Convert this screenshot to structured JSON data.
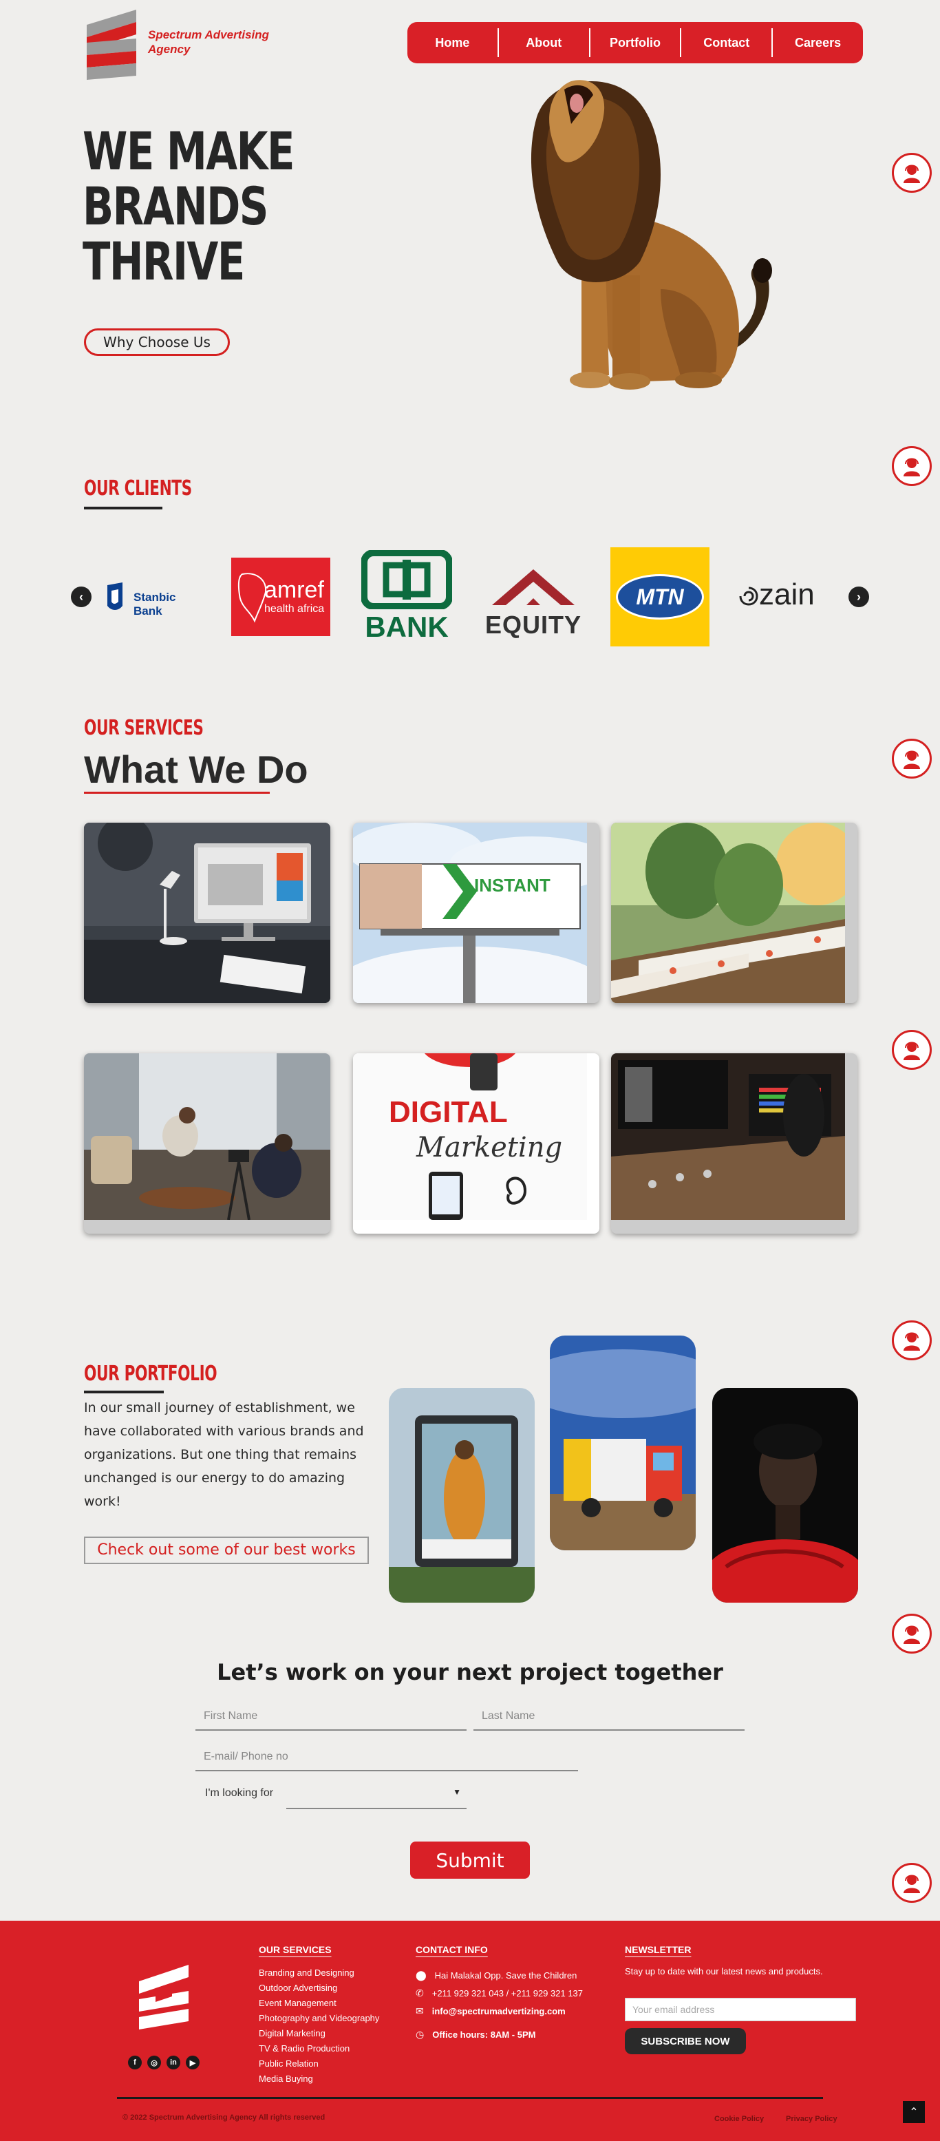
{
  "brand": {
    "name_line1": "Spectrum Advertising",
    "name_line2": "Agency"
  },
  "nav": {
    "items": [
      {
        "label": "Home"
      },
      {
        "label": "About"
      },
      {
        "label": "Portfolio"
      },
      {
        "label": "Contact"
      },
      {
        "label": "Careers"
      }
    ]
  },
  "hero": {
    "title_line1": "WE MAKE",
    "title_line2": "BRANDS",
    "title_line3": "THRIVE",
    "cta": "Why Choose Us"
  },
  "clients": {
    "heading": "OUR CLIENTS",
    "logos": [
      {
        "name": "Stanbic Bank"
      },
      {
        "name_line1": "amref",
        "name_line2": "health africa"
      },
      {
        "name": "BANK"
      },
      {
        "name": "EQUITY"
      },
      {
        "name": "MTN"
      },
      {
        "name": "zain"
      }
    ]
  },
  "services": {
    "heading": "OUR SERVICES",
    "title": "What We Do",
    "billboard_text": "INSTANT",
    "digital_word": "DIGITAL",
    "marketing_word": "Marketing"
  },
  "portfolio": {
    "heading": "OUR PORTFOLIO",
    "text": "In our small journey of establishment, we have collaborated with various brands and organizations. But one thing that remains unchanged is our energy to do amazing work!",
    "cta": "Check out some of our best works"
  },
  "contact_form": {
    "title": "Let’s work on your next project together",
    "first_name_placeholder": "First Name",
    "last_name_placeholder": "Last Name",
    "contact_placeholder": "E-mail/ Phone no",
    "looking_for_label": "I'm looking for",
    "submit": "Submit"
  },
  "footer": {
    "services_heading": "OUR SERVICES",
    "services": [
      "Branding and Designing",
      "Outdoor Advertising",
      "Event Management",
      "Photography and Videography",
      "Digital Marketing",
      "TV & Radio Production",
      "Public Relation",
      "Media Buying"
    ],
    "contact_heading": "CONTACT INFO",
    "address": "Hai Malakal Opp. Save the Children",
    "phone": "+211 929 321 043 / +211 929 321 137",
    "email": "info@spectrumadvertizing.com",
    "hours": "Office hours: 8AM - 5PM",
    "newsletter_heading": "NEWSLETTER",
    "newsletter_text": "Stay up to date with our latest news and products.",
    "email_placeholder": "Your email address",
    "subscribe": "SUBSCRIBE NOW",
    "copyright": "© 2022 Spectrum Advertising Agency All rights reserved",
    "cookie": "Cookie Policy",
    "privacy": "Privacy Policy"
  },
  "colors": {
    "accent": "#d92027",
    "background": "#efeeec",
    "dark": "#222222"
  }
}
